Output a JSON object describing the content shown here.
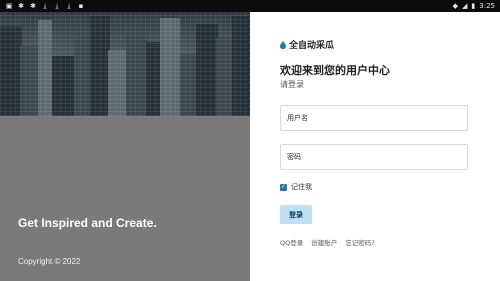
{
  "status_bar": {
    "left_icons": [
      "image-icon",
      "app-icon",
      "app-icon",
      "download-icon",
      "download-icon",
      "download-icon",
      "square-icon"
    ],
    "time": "3:25"
  },
  "left_panel": {
    "tagline": "Get Inspired and Create.",
    "copyright": "Copyright © 2022"
  },
  "brand": {
    "name": "全自动采瓜"
  },
  "welcome": {
    "title": "欢迎来到您的用户中心",
    "subtitle": "请登录"
  },
  "form": {
    "username_placeholder": "用户名",
    "password_placeholder": "密码",
    "remember_label": "记住我",
    "remember_checked": true,
    "login_label": "登录"
  },
  "links": {
    "qq_login": "QQ登录",
    "create_account": "创建账户",
    "forgot_password": "忘记密码?"
  },
  "colors": {
    "accent": "#1f77b4",
    "button_bg": "#bfe0f3",
    "left_panel_bg": "#7a7a7a"
  }
}
